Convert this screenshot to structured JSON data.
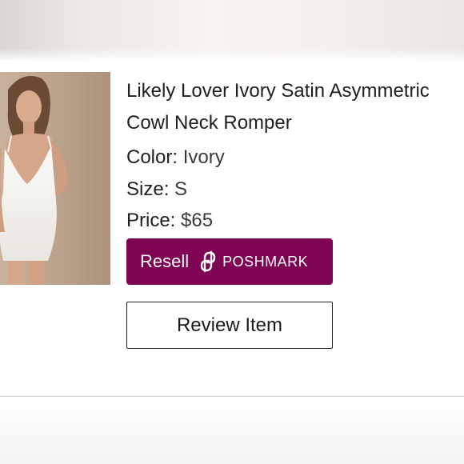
{
  "product": {
    "title_line1": "Likely Lover Ivory Satin Asymmetric",
    "title_line2": "Cowl Neck Romper",
    "color_label": "Color:",
    "color_value": "Ivory",
    "size_label": "Size:",
    "size_value": "S",
    "price_label": "Price:",
    "price_value": "$65",
    "image_alt": "Model wearing ivory satin romper"
  },
  "buttons": {
    "resell_label": "Resell",
    "resell_brand": "POSHMARK",
    "review_label": "Review Item"
  },
  "colors": {
    "poshmark_maroon": "#7f0353",
    "photo_background": "#b9a28d",
    "text": "#1f1f1f"
  },
  "icons": {
    "brand_icon": "poshmark-logo-icon"
  }
}
